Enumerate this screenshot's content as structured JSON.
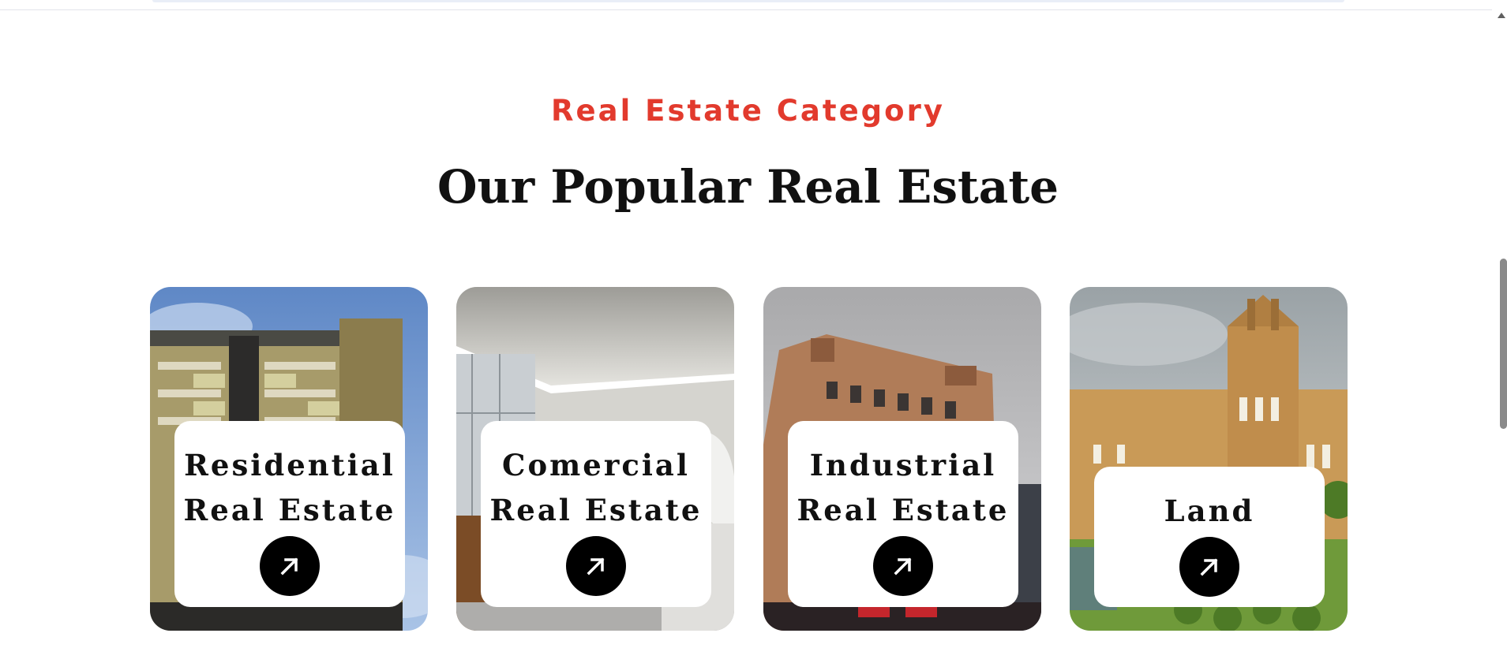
{
  "section": {
    "eyebrow": "Real Estate Category",
    "title": "Our Popular Real Estate"
  },
  "cards": [
    {
      "line1": "Residential",
      "line2": "Real Estate",
      "icon": "arrow-up-right-icon"
    },
    {
      "line1": "Comercial",
      "line2": "Real Estate",
      "icon": "arrow-up-right-icon"
    },
    {
      "line1": "Industrial",
      "line2": "Real Estate",
      "icon": "arrow-up-right-icon"
    },
    {
      "line1": "Land",
      "icon": "arrow-up-right-icon"
    }
  ],
  "colors": {
    "accent": "#e23a2d",
    "heading": "#111111",
    "button": "#000000"
  }
}
